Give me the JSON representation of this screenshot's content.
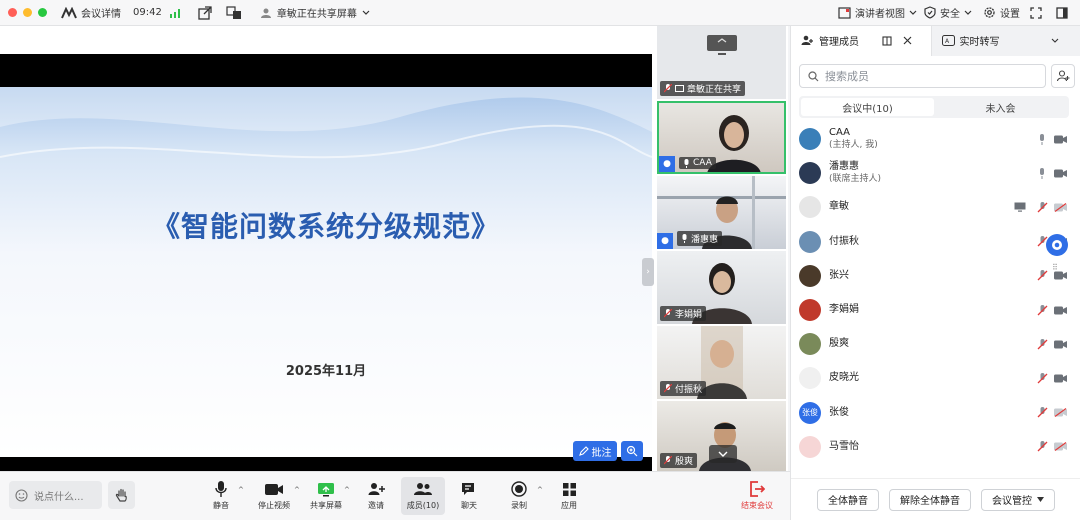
{
  "window": {
    "meeting_details": "会议详情",
    "time": "09:42",
    "sharing_status": "章敏正在共享屏幕",
    "speaker_view": "演讲者视图",
    "security": "安全",
    "settings": "设置"
  },
  "slide": {
    "title": "《智能问数系统分级规范》",
    "date": "2025年11月",
    "annotate_label": "批注"
  },
  "videos": [
    {
      "label": "章敏正在共享",
      "type": "screen"
    },
    {
      "label": "CAA",
      "type": "camera",
      "host": true
    },
    {
      "label": "潘惠惠",
      "type": "camera",
      "cohost": true
    },
    {
      "label": "李娟娟",
      "type": "camera"
    },
    {
      "label": "付振秋",
      "type": "camera"
    },
    {
      "label": "殷爽",
      "type": "camera"
    }
  ],
  "panel": {
    "tab_members": "管理成员",
    "tab_transcribe": "实时转写",
    "search_placeholder": "搜索成员",
    "seg_in_meeting": "会议中(10)",
    "seg_not_joined": "未入会",
    "members": [
      {
        "name": "CAA",
        "role": "(主持人, 我)",
        "avatar_color": "#3a7fb8",
        "mic": "on",
        "cam": "on"
      },
      {
        "name": "潘惠惠",
        "role": "(联席主持人)",
        "avatar_color": "#2b3a55",
        "mic": "on",
        "cam": "on"
      },
      {
        "name": "章敏",
        "role": "",
        "avatar_color": "#e6e6e6",
        "mic": "muted",
        "cam": "off",
        "sharing": true
      },
      {
        "name": "付振秋",
        "role": "",
        "avatar_color": "#6b8fb3",
        "mic": "muted",
        "cam": "on"
      },
      {
        "name": "张兴",
        "role": "",
        "avatar_color": "#4a3a2a",
        "mic": "muted",
        "cam": "on"
      },
      {
        "name": "李娟娟",
        "role": "",
        "avatar_color": "#c0392b",
        "mic": "muted",
        "cam": "on"
      },
      {
        "name": "殷爽",
        "role": "",
        "avatar_color": "#7a8a5a",
        "mic": "muted",
        "cam": "on"
      },
      {
        "name": "皮晓光",
        "role": "",
        "avatar_color": "#f0f0f0",
        "mic": "muted",
        "cam": "on"
      },
      {
        "name": "张俊",
        "role": "",
        "avatar_text": "张俊",
        "avatar_color": "#2f6ee6",
        "mic": "muted",
        "cam": "off"
      },
      {
        "name": "马雪怡",
        "role": "",
        "avatar_color": "#f6d6d6",
        "mic": "muted",
        "cam": "off"
      }
    ],
    "btn_mute_all": "全体静音",
    "btn_unmute_all": "解除全体静音",
    "btn_control": "会议管控"
  },
  "toolbar": {
    "chat_placeholder": "说点什么...",
    "mute": "静音",
    "stop_video": "停止视频",
    "share_screen": "共享屏幕",
    "invite": "邀请",
    "members": "成员(10)",
    "chat": "聊天",
    "record": "录制",
    "apps": "应用",
    "end": "结束会议"
  }
}
